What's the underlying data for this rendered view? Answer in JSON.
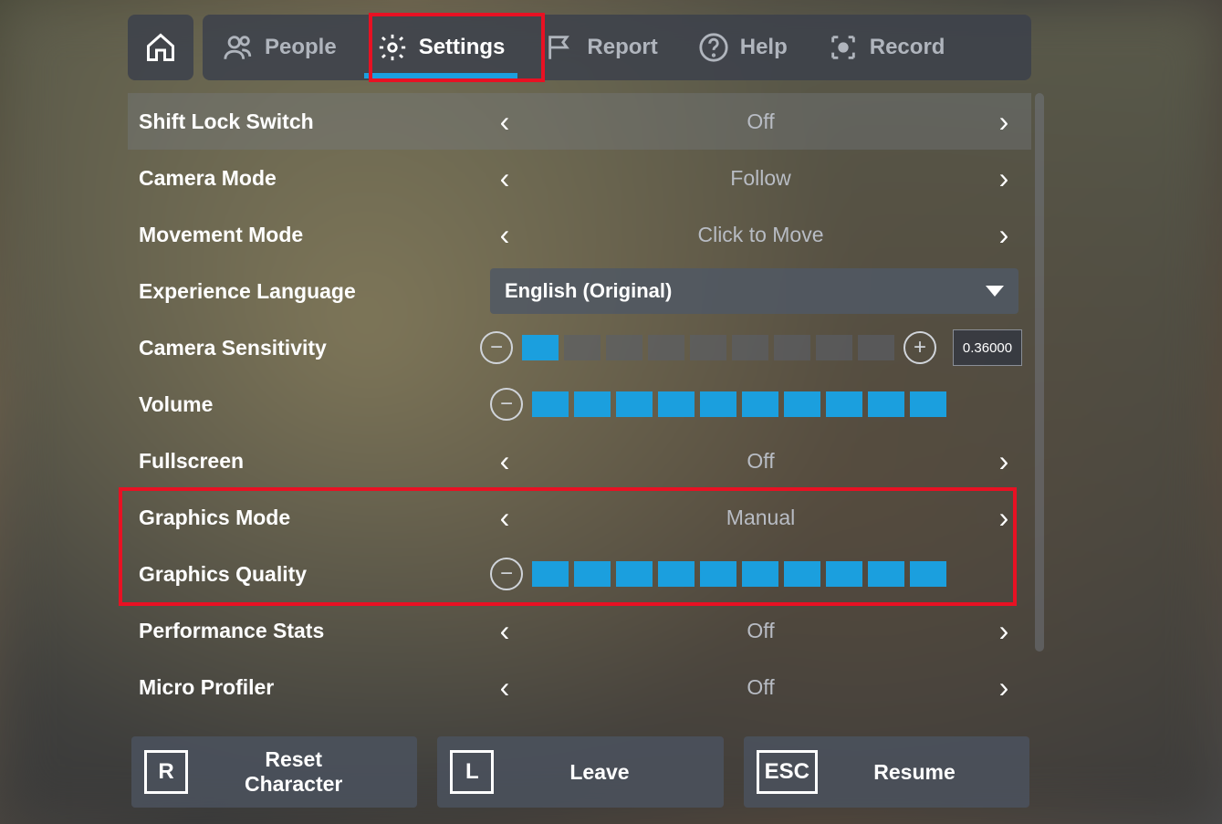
{
  "tabs": {
    "people": "People",
    "settings": "Settings",
    "report": "Report",
    "help": "Help",
    "record": "Record"
  },
  "settings": {
    "shift_lock": {
      "label": "Shift Lock Switch",
      "value": "Off"
    },
    "camera_mode": {
      "label": "Camera Mode",
      "value": "Follow"
    },
    "movement_mode": {
      "label": "Movement Mode",
      "value": "Click to Move"
    },
    "exp_lang": {
      "label": "Experience Language",
      "value": "English (Original)"
    },
    "cam_sens": {
      "label": "Camera Sensitivity",
      "value": "0.36000",
      "filled": 1,
      "total": 10
    },
    "volume": {
      "label": "Volume",
      "filled": 10,
      "total": 10
    },
    "fullscreen": {
      "label": "Fullscreen",
      "value": "Off"
    },
    "gfx_mode": {
      "label": "Graphics Mode",
      "value": "Manual"
    },
    "gfx_quality": {
      "label": "Graphics Quality",
      "filled": 10,
      "total": 10
    },
    "perf_stats": {
      "label": "Performance Stats",
      "value": "Off"
    },
    "micro_profiler": {
      "label": "Micro Profiler",
      "value": "Off"
    }
  },
  "footer": {
    "reset": {
      "key": "R",
      "label": "Reset Character"
    },
    "leave": {
      "key": "L",
      "label": "Leave"
    },
    "resume": {
      "key": "ESC",
      "label": "Resume"
    }
  }
}
